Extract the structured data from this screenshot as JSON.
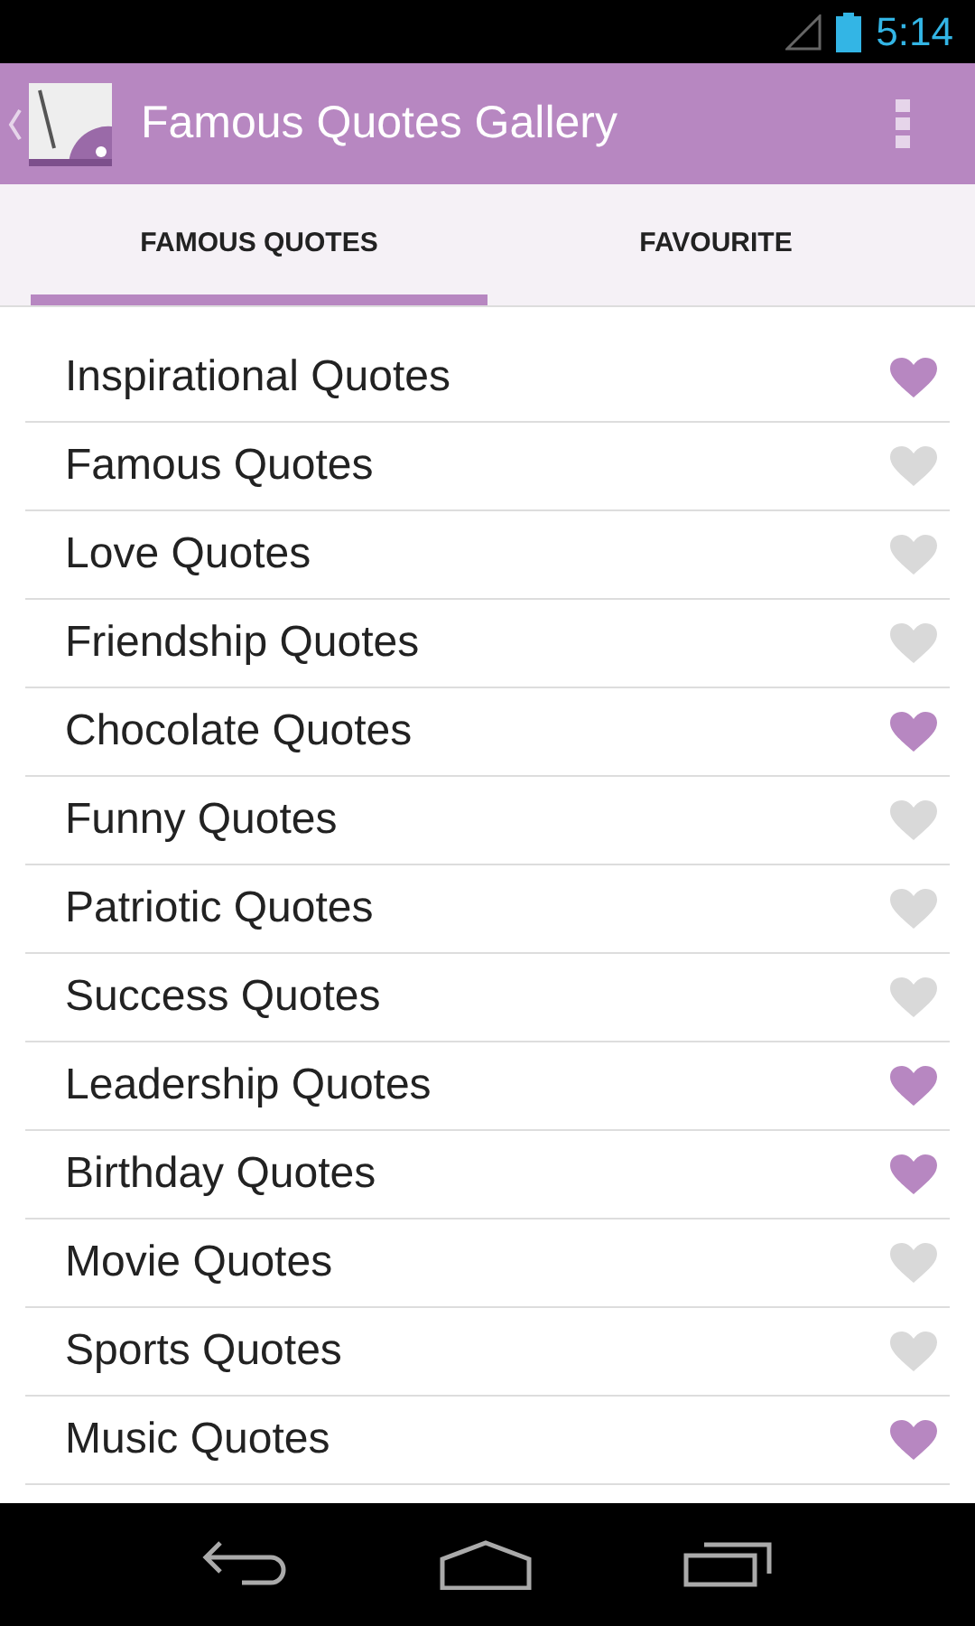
{
  "status_bar": {
    "time": "5:14"
  },
  "app_bar": {
    "title": "Famous Quotes Gallery"
  },
  "tabs": [
    {
      "label": "FAMOUS QUOTES",
      "selected": true
    },
    {
      "label": "FAVOURITE",
      "selected": false
    }
  ],
  "items": [
    {
      "label": "Inspirational Quotes",
      "favourite": true
    },
    {
      "label": "Famous Quotes",
      "favourite": false
    },
    {
      "label": "Love Quotes",
      "favourite": false
    },
    {
      "label": "Friendship Quotes",
      "favourite": false
    },
    {
      "label": "Chocolate Quotes",
      "favourite": true
    },
    {
      "label": "Funny Quotes",
      "favourite": false
    },
    {
      "label": "Patriotic Quotes",
      "favourite": false
    },
    {
      "label": "Success Quotes",
      "favourite": false
    },
    {
      "label": "Leadership Quotes",
      "favourite": true
    },
    {
      "label": "Birthday Quotes",
      "favourite": true
    },
    {
      "label": "Movie Quotes",
      "favourite": false
    },
    {
      "label": "Sports Quotes",
      "favourite": false
    },
    {
      "label": "Music Quotes",
      "favourite": true
    }
  ]
}
